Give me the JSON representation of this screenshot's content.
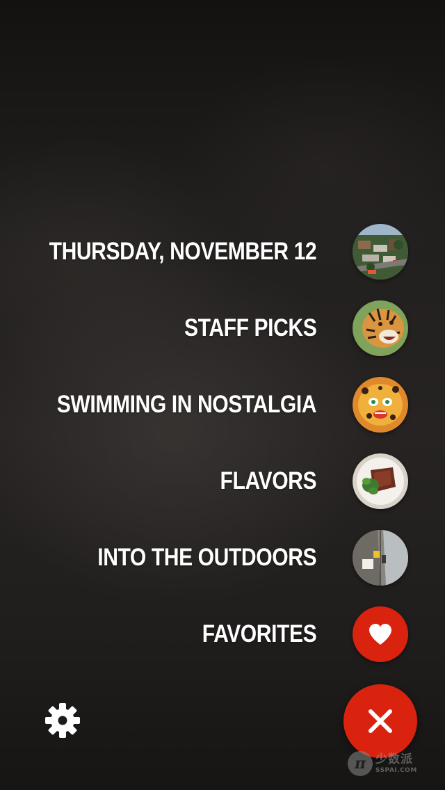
{
  "menu": {
    "items": [
      {
        "label": "THURSDAY, NOVEMBER 12",
        "thumbnail": "aerial-town-photo"
      },
      {
        "label": "STAFF PICKS",
        "thumbnail": "tiger-photo"
      },
      {
        "label": "SWIMMING IN NOSTALGIA",
        "thumbnail": "jaguar-illustration"
      },
      {
        "label": "FLAVORS",
        "thumbnail": "steak-plate-photo"
      },
      {
        "label": "INTO THE OUTDOORS",
        "thumbnail": "climbers-photo"
      },
      {
        "label": "FAVORITES",
        "icon": "heart-icon"
      }
    ]
  },
  "buttons": {
    "close_icon": "close-icon",
    "settings_icon": "gear-icon"
  },
  "watermark": {
    "logo_letter": "π",
    "cn_text": "少数派",
    "en_text": "SSPAI.COM"
  },
  "colors": {
    "accent": "#d9230f",
    "text": "#ffffff",
    "background": "#222020"
  }
}
